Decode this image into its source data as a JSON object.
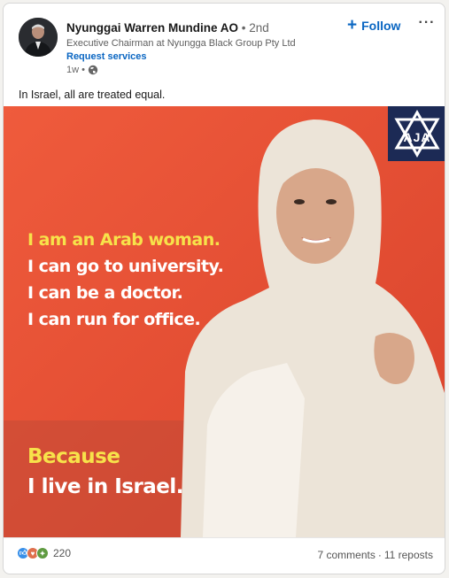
{
  "post": {
    "author": {
      "name": "Nyunggai Warren Mundine AO",
      "degree": "• 2nd",
      "title": "Executive Chairman at Nyungga Black Group Pty Ltd",
      "request_services": "Request services",
      "time": "1w •",
      "visibility_icon": "globe-icon"
    },
    "follow_label": "Follow",
    "more_label": "···",
    "text": "In Israel, all are treated equal.",
    "image": {
      "badge_text": "AJA",
      "lines": [
        "I am an Arab woman.",
        "I can go to university.",
        "I can be a doctor.",
        "I can run for office.",
        "Because",
        "I live in Israel."
      ]
    },
    "social": {
      "reactions": [
        "like-icon",
        "love-icon",
        "insightful-icon"
      ],
      "reaction_count": "220",
      "comments": "7 comments",
      "separator": "·",
      "reposts": "11 reposts"
    }
  },
  "colors": {
    "accent": "#0a66c2",
    "image_bg": "#e8523a",
    "highlight_text": "#f7e24a",
    "badge_bg": "#1c2a55"
  }
}
